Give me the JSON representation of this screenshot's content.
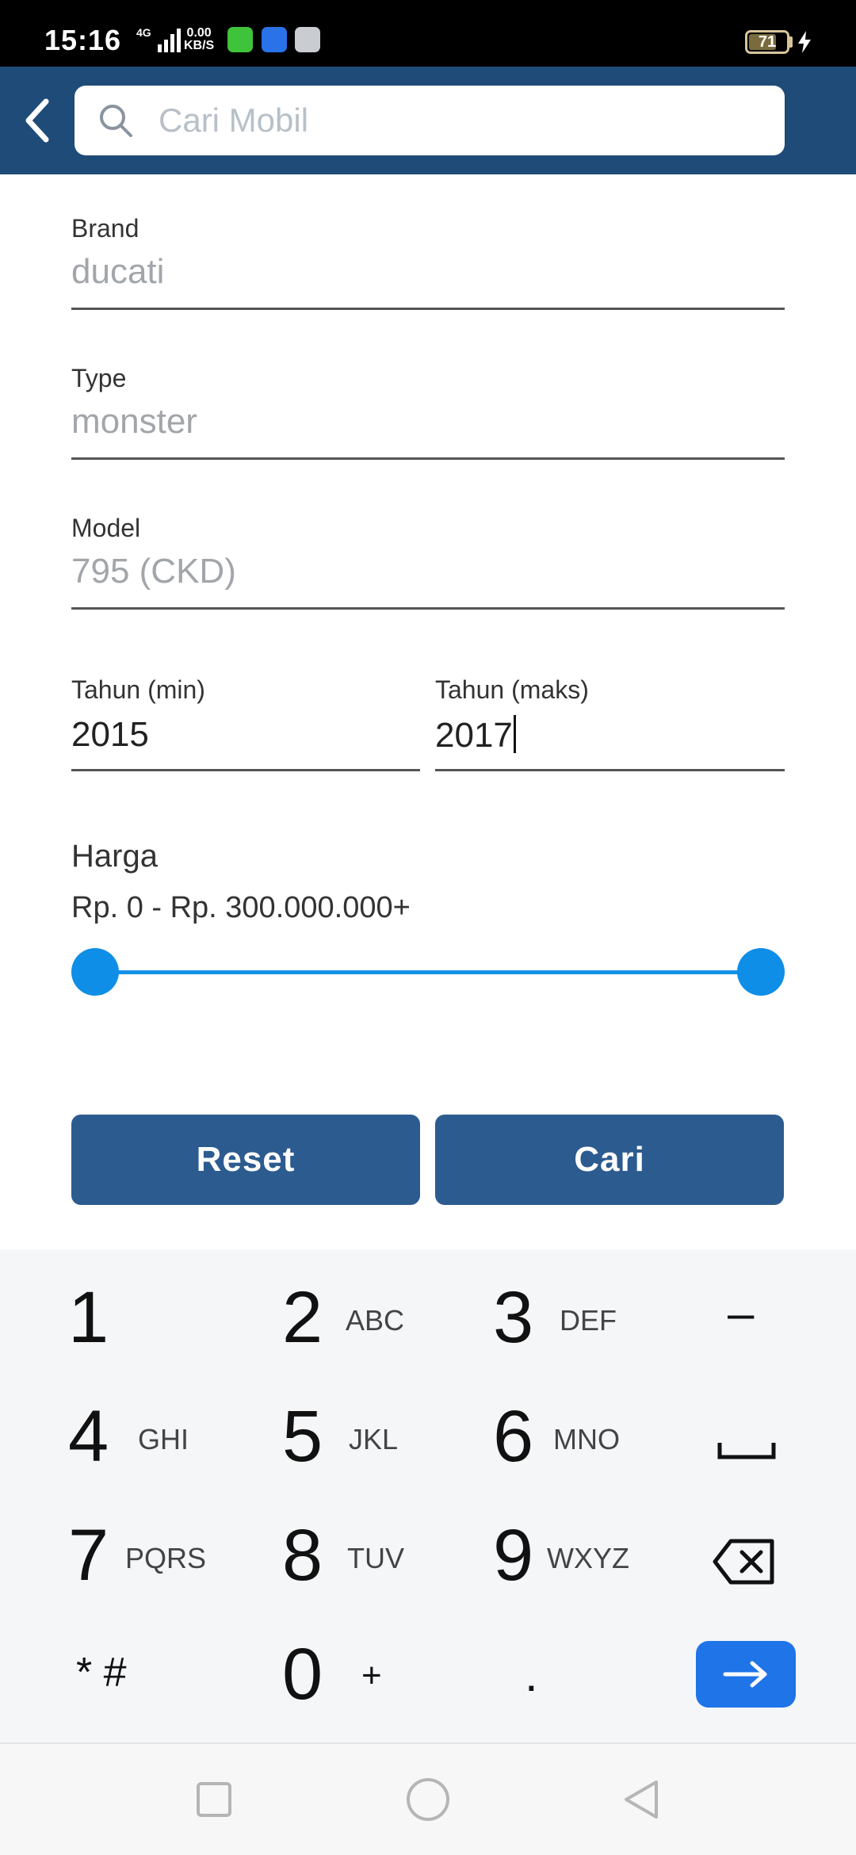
{
  "status_bar": {
    "time": "15:16",
    "network": "4G",
    "speed_value": "0.00",
    "speed_unit": "KB/S",
    "battery": "71"
  },
  "header": {
    "search_placeholder": "Cari Mobil"
  },
  "form": {
    "brand": {
      "label": "Brand",
      "value": "ducati"
    },
    "type": {
      "label": "Type",
      "value": "monster"
    },
    "model": {
      "label": "Model",
      "value": "795 (CKD)"
    },
    "year_min": {
      "label": "Tahun (min)",
      "value": "2015"
    },
    "year_max": {
      "label": "Tahun (maks)",
      "value": "2017"
    },
    "price": {
      "label": "Harga",
      "range_text": "Rp. 0  -  Rp. 300.000.000+",
      "min_fraction": 0,
      "max_fraction": 1
    },
    "reset_label": "Reset",
    "search_label": "Cari"
  },
  "keyboard": {
    "keys": [
      {
        "num": "1",
        "letters": ""
      },
      {
        "num": "2",
        "letters": "ABC"
      },
      {
        "num": "3",
        "letters": "DEF"
      },
      {
        "num": "4",
        "letters": "GHI"
      },
      {
        "num": "5",
        "letters": "JKL"
      },
      {
        "num": "6",
        "letters": "MNO"
      },
      {
        "num": "7",
        "letters": "PQRS"
      },
      {
        "num": "8",
        "letters": "TUV"
      },
      {
        "num": "9",
        "letters": "WXYZ"
      },
      {
        "num": "0",
        "letters": "+"
      }
    ],
    "minus": "–",
    "star_hash": "* #",
    "dot": "."
  },
  "colors": {
    "header": "#1f4b78",
    "button": "#2c5b8f",
    "slider": "#0e8ee6",
    "enter_key": "#1f74e8"
  }
}
